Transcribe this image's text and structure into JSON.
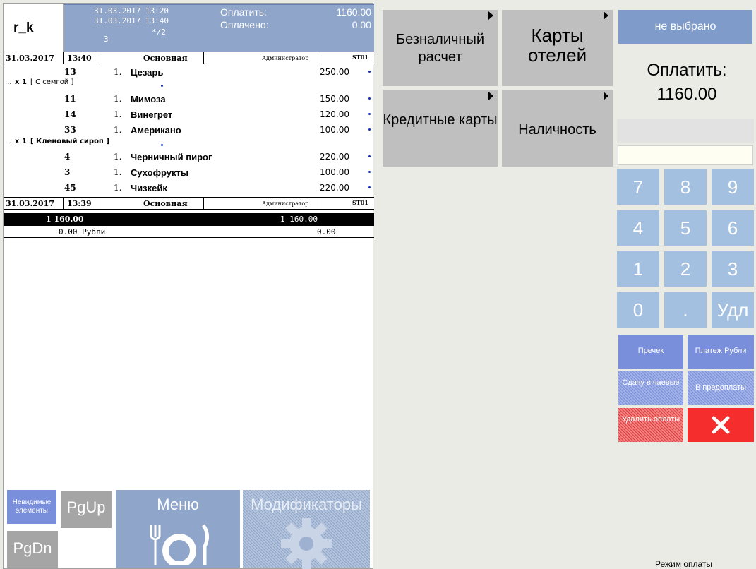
{
  "user": "r_k",
  "order_info": {
    "opened": "31.03.2017 13:20",
    "updated": "31.03.2017 13:40",
    "guests": "3",
    "table": "*/2"
  },
  "pay_info": {
    "to_pay_label": "Оплатить:",
    "to_pay_value": "1160.00",
    "paid_label": "Оплачено:",
    "paid_value": "0.00"
  },
  "order_header_1": {
    "date": "31.03.2017",
    "time": "13:40",
    "name": "Основная",
    "admin": "Администратор",
    "station": "ST01"
  },
  "order_header_2": {
    "date": "31.03.2017",
    "time": "13:39",
    "name": "Основная",
    "admin": "Администратор",
    "station": "ST01"
  },
  "items": [
    {
      "code": "13",
      "qty": "1.",
      "name": "Цезарь",
      "price": "250.00"
    },
    {
      "code": "11",
      "qty": "1.",
      "name": "Мимоза",
      "price": "150.00"
    },
    {
      "code": "14",
      "qty": "1.",
      "name": "Винегрет",
      "price": "120.00"
    },
    {
      "code": "33",
      "qty": "1.",
      "name": "Американо",
      "price": "100.00"
    },
    {
      "code": "4",
      "qty": "1.",
      "name": "Черничный пирог",
      "price": "220.00"
    },
    {
      "code": "3",
      "qty": "1.",
      "name": "Сухофрукты",
      "price": "100.00"
    },
    {
      "code": "45",
      "qty": "1.",
      "name": "Чизкейк",
      "price": "220.00"
    }
  ],
  "modifiers": [
    {
      "mark": "...",
      "mult": "x 1",
      "name": "[ С семгой ]"
    },
    {
      "mark": "...",
      "mult": "x 1",
      "name": "[ Кленовый сироп ]"
    }
  ],
  "totals": {
    "total_left": "1 160.00",
    "total_right": "1 160.00",
    "rest_left": "0.00 Рубли",
    "rest_right": "0.00"
  },
  "bottom_buttons": {
    "invisible": "Невидимые элементы",
    "pgup": "PgUp",
    "pgdn": "PgDn",
    "menu": "Меню",
    "modifiers": "Модификаторы"
  },
  "payment_types": {
    "card": "Безналичный расчет",
    "hotel": "Карты отелей",
    "credit": "Кредитные карты",
    "cash": "Наличность"
  },
  "right_panel": {
    "not_selected": "не выбрано",
    "to_pay_label": "Оплатить:",
    "to_pay_value": "1160.00",
    "keys": [
      "7",
      "8",
      "9",
      "4",
      "5",
      "6",
      "1",
      "2",
      "3",
      "0",
      ".",
      "Удл"
    ],
    "precheck": "Пречек",
    "pay_rub": "Платеж Рубли",
    "tips": "Сдачу в чаевые",
    "prepay": "В предоплаты",
    "delete_payments": "Удалить оплаты"
  },
  "mode_label": "Режим оплаты",
  "colors": {
    "accent_blue": "#8fa5c9",
    "key_blue": "#a3c0e1",
    "action_blue": "#7a8fdc",
    "danger_red": "#f52d2d",
    "gray": "#bfbfbf"
  }
}
